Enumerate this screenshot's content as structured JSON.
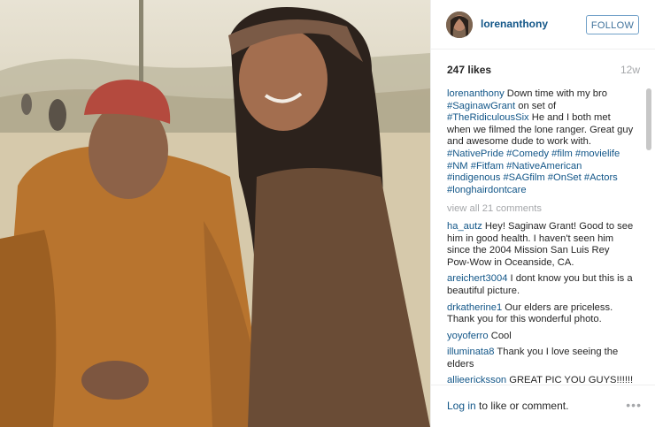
{
  "post": {
    "username": "lorenanthony",
    "follow_label": "FOLLOW",
    "likes": "247 likes",
    "time": "12w",
    "caption": {
      "user": "lorenanthony",
      "text_1": " Down time with my bro ",
      "tag_1": "#SaginawGrant",
      "text_2": " on set of ",
      "tag_2": "#TheRidiculousSix",
      "text_3": " He and I both met when we filmed the lone ranger. Great guy and awesome dude to work with. ",
      "tags": "#NativePride #Comedy #film #movielife #NM #Fitfam #NativeAmerican #indigenous #SAGfilm #OnSet #Actors #longhairdontcare"
    },
    "view_all": "view all 21 comments",
    "comments": [
      {
        "user": "ha_autz",
        "text": " Hey! Saginaw Grant! Good to see him in good health. I haven't seen him since the 2004 Mission San Luis Rey Pow-Wow in Oceanside, CA."
      },
      {
        "user": "areichert3004",
        "text": " I dont know you but this is a beautiful picture."
      },
      {
        "user": "drkatherine1",
        "text": " Our elders are priceless. Thank you for this wonderful photo."
      },
      {
        "user": "yoyoferro",
        "text": " Cool"
      },
      {
        "user": "illuminata8",
        "text": " Thank you I love seeing the elders"
      },
      {
        "user": "allieericksson",
        "text": " GREAT PIC YOU GUYS!!!!!!"
      }
    ],
    "login_link": "Log in",
    "login_text": " to like or comment.",
    "more_icon": "ellipsis-icon"
  }
}
